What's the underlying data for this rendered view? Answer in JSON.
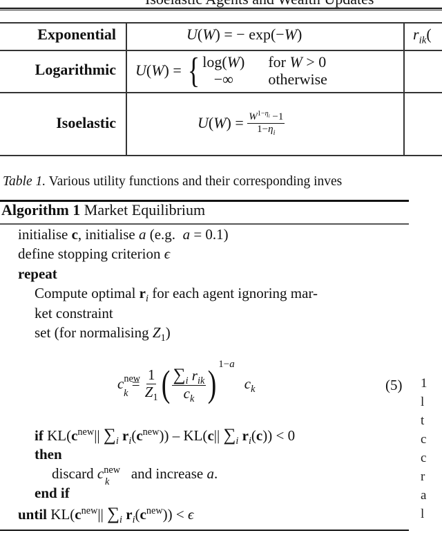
{
  "running_head": "Isoelastic Agents and Wealth Updates",
  "table": {
    "rows": [
      {
        "label": "Exponential",
        "formula_text": "U(W) = − exp(−W)",
        "next_col_text": "r_ik("
      },
      {
        "label": "Logarithmic",
        "formula_lhs": "U(W) =",
        "cases": [
          {
            "value": "log(W)",
            "condition": "for W > 0"
          },
          {
            "value": "−∞",
            "condition": "otherwise"
          }
        ]
      },
      {
        "label": "Isoelastic",
        "formula_lhs": "U(W) =",
        "numerator": "W^(1−η_i) −1",
        "denominator": "1−η_i"
      }
    ]
  },
  "caption": {
    "label": "Table 1.",
    "text": "Various utility functions and their corresponding inves"
  },
  "algorithm": {
    "label": "Algorithm 1",
    "title": "Market Equilibrium",
    "lines": {
      "init": "initialise c, initialise a (e.g. a = 0.1)",
      "stop": "define stopping criterion ϵ",
      "repeat": "repeat",
      "compute_1": "Compute optimal r_i for each agent ignoring mar-",
      "compute_2": "ket constraint",
      "set": "set (for normalising Z_1)",
      "equation": "c_k^new = (1/Z_1) ( Σ_i r_ik / c_k )^(1−a) c_k",
      "equation_number": "(5)",
      "if_cond": "if KL(c^new || Σ_i r_i(c^new)) − KL(c || Σ_i r_i(c)) < 0",
      "then": "then",
      "discard": "discard c_k^new and increase a.",
      "end_if": "end if",
      "until": "until KL(c^new || Σ_i r_i(c^new)) < ϵ"
    },
    "keywords": {
      "repeat": "repeat",
      "if": "if",
      "then": "then",
      "end_if": "end if",
      "until": "until"
    }
  },
  "right_column_fragments": [
    "1",
    "l",
    "t",
    "c",
    "c",
    "r",
    "a",
    "l"
  ]
}
